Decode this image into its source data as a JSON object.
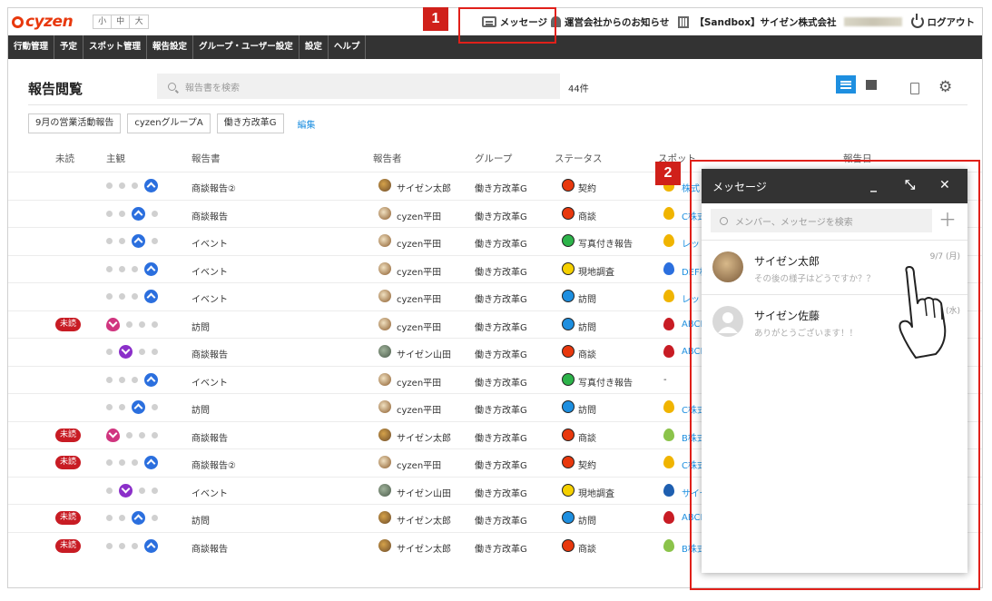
{
  "header": {
    "logo": "cyzen",
    "font_sizes": [
      "小",
      "中",
      "大"
    ],
    "message_label": "メッセージ",
    "notice_label": "運営会社からのお知らせ",
    "company_label": "【Sandbox】サイゼン株式会社",
    "logout_label": "ログアウト"
  },
  "nav": [
    "行動管理",
    "予定",
    "スポット管理",
    "報告設定",
    "グループ・ユーザー設定",
    "設定",
    "ヘルプ"
  ],
  "page": {
    "title": "報告閲覧",
    "search_placeholder": "報告書を検索",
    "count": "44件",
    "filters": [
      "9月の営業活動報告",
      "cyzenグループA",
      "働き方改革G"
    ],
    "edit_label": "編集"
  },
  "columns": [
    "未読",
    "主観",
    "報告書",
    "報告者",
    "グループ",
    "ステータス",
    "スポット",
    "報告日"
  ],
  "rows": [
    {
      "unread": "",
      "mood": "up",
      "report": "商談報告②",
      "reporter": "サイゼン太郎",
      "ava": "cat",
      "group": "働き方改革G",
      "status": "契約",
      "status_color": "#e8380d",
      "spot": "株式",
      "spot_color": "#f0b400"
    },
    {
      "unread": "",
      "mood": "up3",
      "report": "商談報告",
      "reporter": "cyzen平田",
      "ava": "dog",
      "group": "働き方改革G",
      "status": "商談",
      "status_color": "#e8380d",
      "spot": "C株式",
      "spot_color": "#f0b400"
    },
    {
      "unread": "",
      "mood": "up3",
      "report": "イベント",
      "reporter": "cyzen平田",
      "ava": "dog",
      "group": "働き方改革G",
      "status": "写真付き報告",
      "status_color": "#2db34a",
      "spot": "レッド",
      "spot_color": "#f0b400"
    },
    {
      "unread": "",
      "mood": "up",
      "report": "イベント",
      "reporter": "cyzen平田",
      "ava": "dog",
      "group": "働き方改革G",
      "status": "現地調査",
      "status_color": "#f5d000",
      "spot": "DEF株",
      "spot_color": "#2b6fde"
    },
    {
      "unread": "",
      "mood": "up",
      "report": "イベント",
      "reporter": "cyzen平田",
      "ava": "dog",
      "group": "働き方改革G",
      "status": "訪問",
      "status_color": "#1e8fe0",
      "spot": "レッド",
      "spot_color": "#f0b400"
    },
    {
      "unread": "未読",
      "mood": "heart",
      "report": "訪問",
      "reporter": "cyzen平田",
      "ava": "dog",
      "group": "働き方改革G",
      "status": "訪問",
      "status_color": "#1e8fe0",
      "spot": "ABCD",
      "spot_color": "#c81c24"
    },
    {
      "unread": "",
      "mood": "down",
      "report": "商談報告",
      "reporter": "サイゼン山田",
      "ava": "gray",
      "group": "働き方改革G",
      "status": "商談",
      "status_color": "#e8380d",
      "spot": "ABCD",
      "spot_color": "#c81c24"
    },
    {
      "unread": "",
      "mood": "up",
      "report": "イベント",
      "reporter": "cyzen平田",
      "ava": "dog",
      "group": "働き方改革G",
      "status": "写真付き報告",
      "status_color": "#2db34a",
      "spot": "-",
      "spot_color": ""
    },
    {
      "unread": "",
      "mood": "up3",
      "report": "訪問",
      "reporter": "cyzen平田",
      "ava": "dog",
      "group": "働き方改革G",
      "status": "訪問",
      "status_color": "#1e8fe0",
      "spot": "C株式",
      "spot_color": "#f0b400"
    },
    {
      "unread": "未読",
      "mood": "heart",
      "report": "商談報告",
      "reporter": "サイゼン太郎",
      "ava": "cat",
      "group": "働き方改革G",
      "status": "商談",
      "status_color": "#e8380d",
      "spot": "B株式",
      "spot_color": "#8bc34a"
    },
    {
      "unread": "未読",
      "mood": "up",
      "report": "商談報告②",
      "reporter": "cyzen平田",
      "ava": "dog",
      "group": "働き方改革G",
      "status": "契約",
      "status_color": "#e8380d",
      "spot": "C株式",
      "spot_color": "#f0b400"
    },
    {
      "unread": "",
      "mood": "down",
      "report": "イベント",
      "reporter": "サイゼン山田",
      "ava": "gray",
      "group": "働き方改革G",
      "status": "現地調査",
      "status_color": "#f5d000",
      "spot": "サイゼ",
      "spot_color": "#1e5fb0"
    },
    {
      "unread": "未読",
      "mood": "up3",
      "report": "訪問",
      "reporter": "サイゼン太郎",
      "ava": "cat",
      "group": "働き方改革G",
      "status": "訪問",
      "status_color": "#1e8fe0",
      "spot": "ABCD",
      "spot_color": "#c81c24"
    },
    {
      "unread": "未読",
      "mood": "up",
      "report": "商談報告",
      "reporter": "サイゼン太郎",
      "ava": "cat",
      "group": "働き方改革G",
      "status": "商談",
      "status_color": "#e8380d",
      "spot": "B株式",
      "spot_color": "#8bc34a"
    }
  ],
  "panel": {
    "title": "メッセージ",
    "search_placeholder": "メンバー、メッセージを検索",
    "conversations": [
      {
        "name": "サイゼン太郎",
        "preview": "その後の様子はどうですか？？",
        "date": "9/7 (月)"
      },
      {
        "name": "サイゼン佐藤",
        "preview": "ありがとうございます！！",
        "date": "(水)"
      }
    ]
  },
  "annotations": [
    "1",
    "2"
  ],
  "colors": {
    "accent": "#1e8fe0",
    "annotation": "#e0201a",
    "nav_bg": "#333333",
    "brand": "#e8380d"
  }
}
